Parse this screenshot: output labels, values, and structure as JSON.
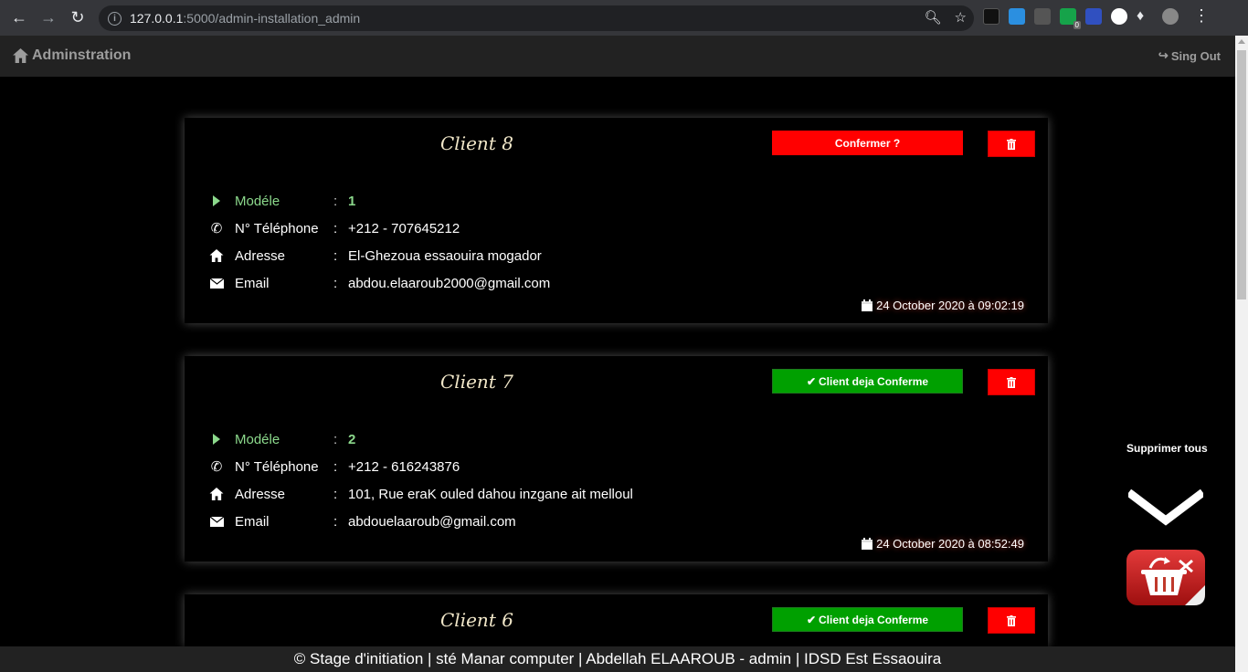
{
  "browser": {
    "url_host": "127.0.0.1",
    "url_path": ":5000/admin-installation_admin",
    "extension_badge": "0"
  },
  "header": {
    "brand": "Adminstration",
    "signout": "Sing Out"
  },
  "labels": {
    "model": "Modéle",
    "phone": "N° Téléphone",
    "address": "Adresse",
    "email": "Email",
    "colon": ":"
  },
  "clients": [
    {
      "title": "Client 8",
      "action": "Confermer ?",
      "confirmed": false,
      "model": "1",
      "phone": "+212 - 707645212",
      "address": "El-Ghezoua essaouira mogador",
      "email": "abdou.elaaroub2000@gmail.com",
      "date": "24 October 2020 à 09:02:19"
    },
    {
      "title": "Client 7",
      "action": "Client deja Conferme",
      "confirmed": true,
      "model": "2",
      "phone": "+212 - 616243876",
      "address": "101, Rue eraK ouled dahou inzgane ait melloul",
      "email": "abdouelaaroub@gmail.com",
      "date": "24 October 2020 à 08:52:49"
    },
    {
      "title": "Client 6",
      "action": "Client deja Conferme",
      "confirmed": true
    }
  ],
  "sidebar": {
    "delete_all": "Supprimer tous"
  },
  "footer": {
    "text": "© Stage d'initiation | sté Manar computer | Abdellah ELAAROUB - admin | IDSD Est Essaouira"
  },
  "colors": {
    "confirm_red": "#ff0000",
    "confirmed_green": "#00a000",
    "label_green": "#8cd98c",
    "header_bg": "#222222"
  }
}
